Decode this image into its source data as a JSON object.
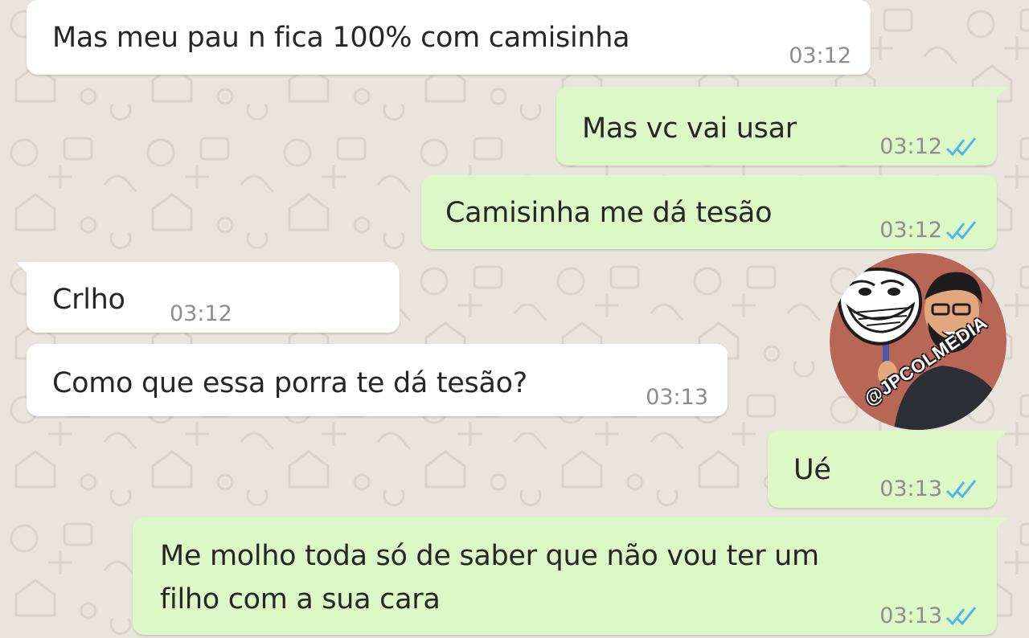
{
  "chat": {
    "messages": [
      {
        "direction": "incoming",
        "text": "Mas meu pau n fica 100% com camisinha",
        "time": "03:12"
      },
      {
        "direction": "outgoing",
        "text": "Mas vc vai usar",
        "time": "03:12",
        "status": "read"
      },
      {
        "direction": "outgoing",
        "text": "Camisinha me dá tesão",
        "time": "03:12",
        "status": "read"
      },
      {
        "direction": "incoming",
        "text": "Crlho",
        "time": "03:12"
      },
      {
        "direction": "incoming",
        "text": "Como que essa porra te dá tesão?",
        "time": "03:13"
      },
      {
        "direction": "outgoing",
        "text": "Ué",
        "time": "03:13",
        "status": "read"
      },
      {
        "direction": "outgoing",
        "text_lines": [
          "Me molho toda só de saber que não vou ter um",
          "filho com a sua cara"
        ],
        "time": "03:13",
        "status": "read"
      }
    ]
  },
  "watermark": {
    "handle": "@JPCOLMEDIA",
    "icon": "trollface-avatar-icon"
  },
  "colors": {
    "wallpaper": "#e9e4dc",
    "incoming_bubble": "#ffffff",
    "outgoing_bubble": "#dcf8c6",
    "message_text": "#262626",
    "timestamp": "#8d8d8d",
    "read_ticks": "#4fb6ec",
    "badge_background": "#b86656"
  }
}
